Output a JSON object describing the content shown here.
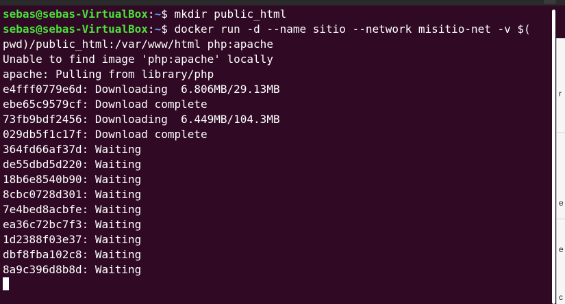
{
  "terminal": {
    "prompt": {
      "user_host": "sebas@sebas-VirtualBox",
      "path": "~",
      "symbol": "$"
    },
    "lines": [
      {
        "type": "prompt",
        "command": " mkdir public_html"
      },
      {
        "type": "prompt",
        "command": " docker run -d --name sitio --network misitio-net -v $("
      },
      {
        "type": "output",
        "text": "pwd)/public_html:/var/www/html php:apache"
      },
      {
        "type": "output",
        "text": "Unable to find image 'php:apache' locally"
      },
      {
        "type": "output",
        "text": "apache: Pulling from library/php"
      },
      {
        "type": "output",
        "text": "e4fff0779e6d: Downloading  6.806MB/29.13MB"
      },
      {
        "type": "output",
        "text": "ebe65c9579cf: Download complete"
      },
      {
        "type": "output",
        "text": "73fb9bdf2456: Downloading  6.449MB/104.3MB"
      },
      {
        "type": "output",
        "text": "029db5f1c17f: Download complete"
      },
      {
        "type": "output",
        "text": "364fd66af37d: Waiting"
      },
      {
        "type": "output",
        "text": "de55dbd5d220: Waiting"
      },
      {
        "type": "output",
        "text": "18b6e8540b90: Waiting"
      },
      {
        "type": "output",
        "text": "8cbc0728d301: Waiting"
      },
      {
        "type": "output",
        "text": "7e4bed8acbfe: Waiting"
      },
      {
        "type": "output",
        "text": "ea36c72bc7f3: Waiting"
      },
      {
        "type": "output",
        "text": "1d2388f03e37: Waiting"
      },
      {
        "type": "output",
        "text": "dbf8fba102c8: Waiting"
      },
      {
        "type": "output",
        "text": "8a9c396d8b8d: Waiting"
      }
    ]
  },
  "side_window": {
    "fragments": [
      "r",
      "e",
      "e",
      "c"
    ]
  },
  "colors": {
    "background": "#300a24",
    "user_host": "#4ae23a",
    "path": "#6aa4ff",
    "text": "#ffffff"
  }
}
